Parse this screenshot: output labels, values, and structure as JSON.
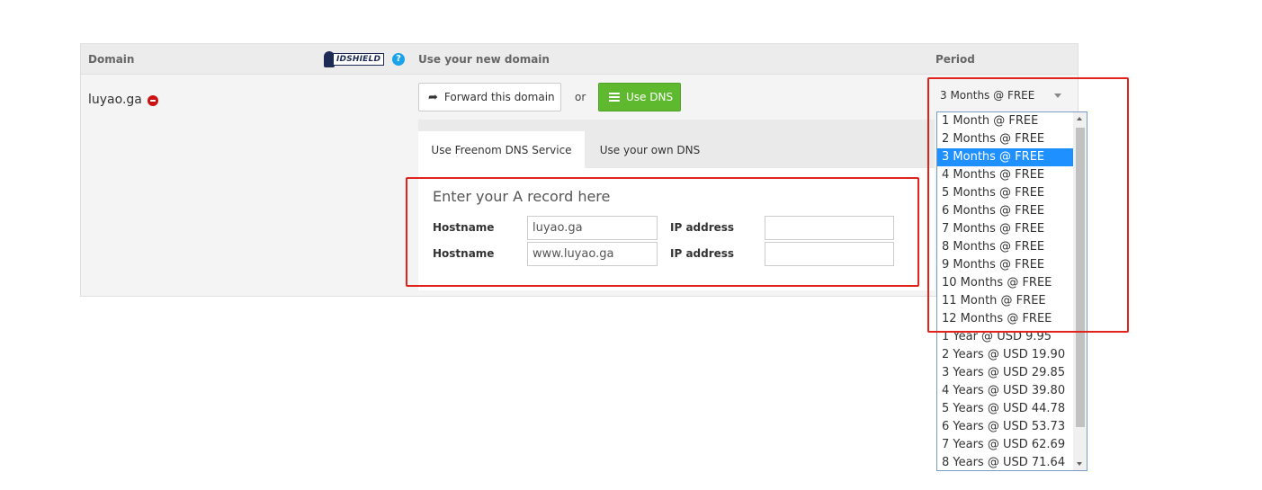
{
  "header": {
    "domain_label": "Domain",
    "idshield_text": "IDSHIELD",
    "help_icon": "?",
    "use_domain_label": "Use your new domain",
    "period_label": "Period"
  },
  "domain_row": {
    "domain_name": "luyao.ga",
    "forward_button": "Forward this domain",
    "or_text": "or",
    "dns_button": "Use DNS"
  },
  "tabs": [
    {
      "label": "Use Freenom DNS Service",
      "active": true
    },
    {
      "label": "Use your own DNS",
      "active": false
    }
  ],
  "a_record": {
    "title": "Enter your A record here",
    "rows": [
      {
        "hostname_label": "Hostname",
        "hostname_value": "luyao.ga",
        "ip_label": "IP address",
        "ip_value": ""
      },
      {
        "hostname_label": "Hostname",
        "hostname_value": "www.luyao.ga",
        "ip_label": "IP address",
        "ip_value": ""
      }
    ]
  },
  "period": {
    "selected": "3 Months @ FREE",
    "options": [
      "1 Month @ FREE",
      "2 Months @ FREE",
      "3 Months @ FREE",
      "4 Months @ FREE",
      "5 Months @ FREE",
      "6 Months @ FREE",
      "7 Months @ FREE",
      "8 Months @ FREE",
      "9 Months @ FREE",
      "10 Months @ FREE",
      "11 Month @ FREE",
      "12 Months @ FREE",
      "1 Year @ USD 9.95",
      "2 Years @ USD 19.90",
      "3 Years @ USD 29.85",
      "4 Years @ USD 39.80",
      "5 Years @ USD 44.78",
      "6 Years @ USD 53.73",
      "7 Years @ USD 62.69",
      "8 Years @ USD 71.64"
    ],
    "highlighted_index": 2
  },
  "colors": {
    "use_dns_green": "#5eb92f",
    "highlight_blue": "#1e90ff",
    "annotation_red": "#e0231c",
    "remove_red": "#cc1111",
    "help_blue": "#1aa3e8"
  },
  "icons": {
    "forward": "share-arrow-icon",
    "dns": "list-icon",
    "remove": "minus-circle-icon",
    "help": "question-circle-icon"
  }
}
